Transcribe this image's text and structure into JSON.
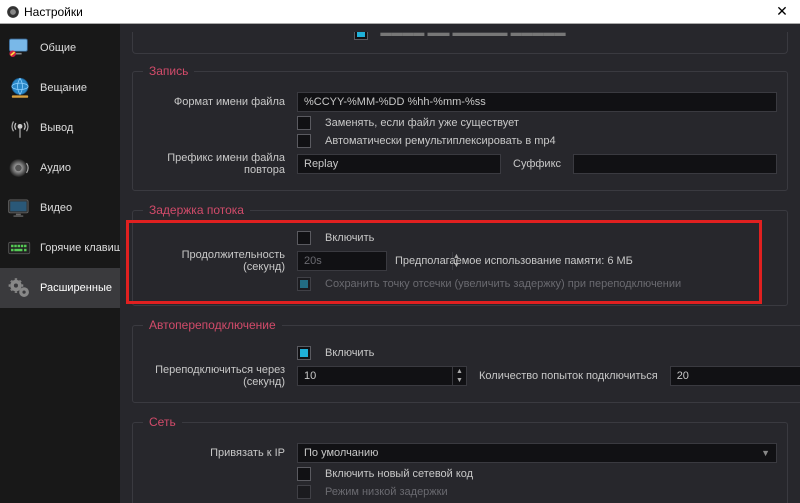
{
  "titlebar": {
    "title": "Настройки",
    "close": "✕"
  },
  "sidebar": {
    "items": [
      {
        "label": "Общие"
      },
      {
        "label": "Вещание"
      },
      {
        "label": "Вывод"
      },
      {
        "label": "Аудио"
      },
      {
        "label": "Видео"
      },
      {
        "label": "Горячие клавиши"
      },
      {
        "label": "Расширенные"
      }
    ]
  },
  "recording": {
    "legend": "Запись",
    "filename_format_label": "Формат имени файла",
    "filename_format_value": "%CCYY-%MM-%DD %hh-%mm-%ss",
    "overwrite_label": "Заменять, если файл уже существует",
    "auto_remux_label": "Автоматически ремультиплексировать в mp4",
    "replay_prefix_label": "Префикс имени файла повтора",
    "replay_prefix_value": "Replay",
    "suffix_label": "Суффикс",
    "suffix_value": ""
  },
  "delay": {
    "legend": "Задержка потока",
    "enable_label": "Включить",
    "duration_label": "Продолжительность (секунд)",
    "duration_value": "20s",
    "memory_text": "Предполагаемое использование памяти: 6 МБ",
    "preserve_label": "Сохранить точку отсечки (увеличить задержку) при переподключении"
  },
  "reconnect": {
    "legend": "Автопереподключение",
    "enable_label": "Включить",
    "retry_delay_label": "Переподключиться через (секунд)",
    "retry_delay_value": "10",
    "max_retries_label": "Количество попыток подключиться",
    "max_retries_value": "20"
  },
  "network": {
    "legend": "Сеть",
    "bind_ip_label": "Привязать к IP",
    "bind_ip_value": "По умолчанию",
    "new_code_label": "Включить новый сетевой код",
    "low_latency_label": "Режим низкой задержки"
  }
}
